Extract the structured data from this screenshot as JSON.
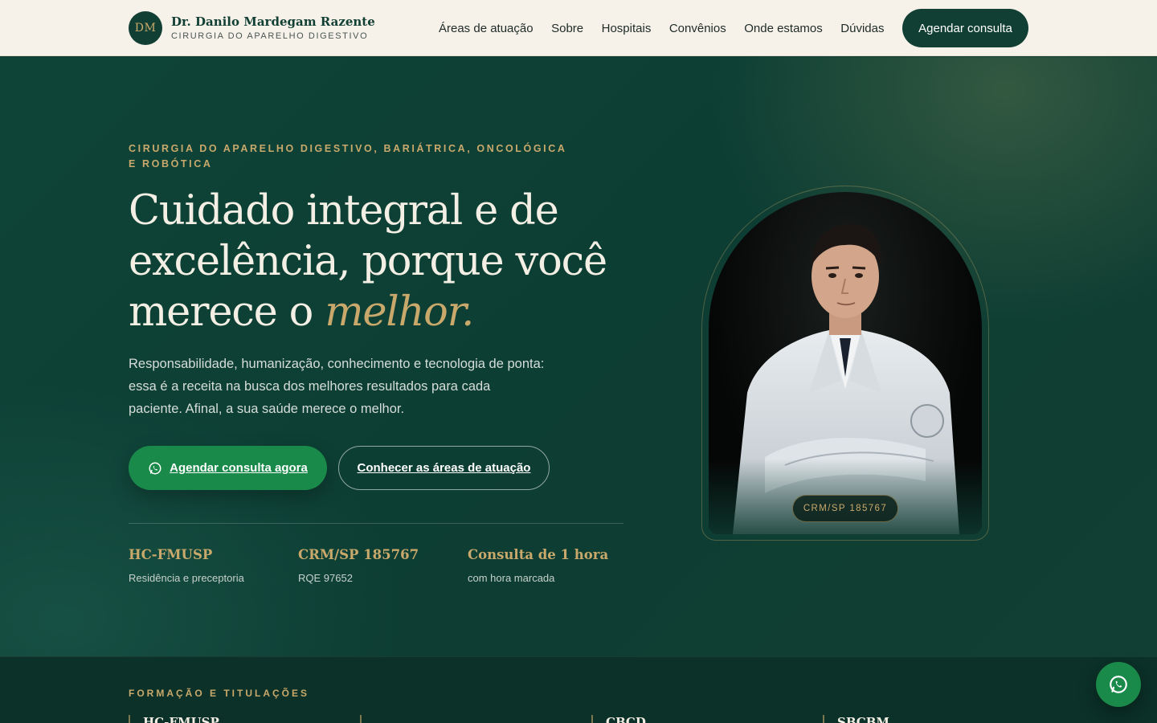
{
  "brand": {
    "initials": "DM",
    "name": "Dr. Danilo Mardegam Razente",
    "subtitle": "CIRURGIA DO APARELHO DIGESTIVO"
  },
  "nav": {
    "items": [
      "Áreas de atuação",
      "Sobre",
      "Hospitais",
      "Convênios",
      "Onde estamos",
      "Dúvidas"
    ],
    "cta": "Agendar consulta"
  },
  "hero": {
    "eyebrow": "CIRURGIA DO APARELHO DIGESTIVO, BARIÁTRICA, ONCOLÓGICA E ROBÓTICA",
    "headline_line1": "Cuidado integral e de",
    "headline_line2": "excelência, porque você",
    "headline_line3": "merece o",
    "headline_accent": "melhor.",
    "lead": "Responsabilidade, humanização, conhecimento e tecnologia de ponta: essa é a receita na busca dos melhores resultados para cada paciente. Afinal, a sua saúde merece o melhor.",
    "primary_button": "Agendar consulta agora",
    "secondary_button": "Conhecer as áreas de atuação",
    "stats": [
      {
        "title": "HC-FMUSP",
        "subtitle": "Residência e preceptoria"
      },
      {
        "title": "CRM/SP 185767",
        "subtitle": "RQE 97652"
      },
      {
        "title": "Consulta de 1 hora",
        "subtitle": "com hora marcada"
      }
    ],
    "portrait_badge": "CRM/SP 185767"
  },
  "credentials": {
    "eyebrow": "FORMAÇÃO E TITULAÇÕES",
    "items": [
      "HC-FMUSP",
      "",
      "CBCD",
      "SBCBM"
    ]
  },
  "colors": {
    "accent_gold": "#c9a96b",
    "brand_green": "#123f33",
    "whatsapp_green": "#1a8a4a",
    "header_bg": "#f6f2ea"
  },
  "icons": {
    "whatsapp": "whatsapp-icon"
  }
}
